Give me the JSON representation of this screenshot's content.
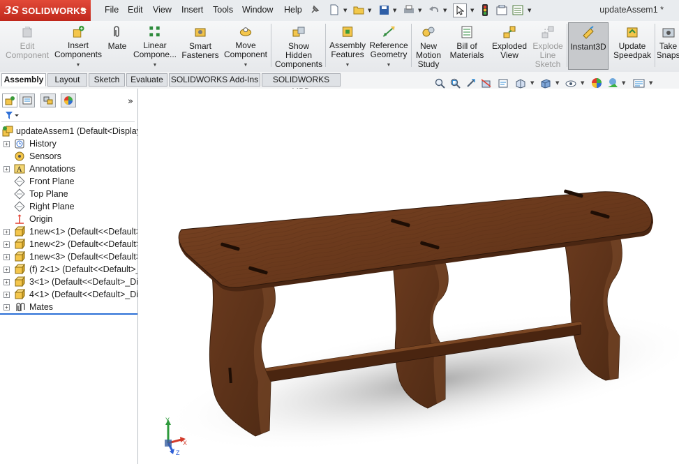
{
  "app": {
    "logo_prefix": "3S",
    "logo_name": "SOLIDWORKS",
    "document_title": "updateAssem1 *"
  },
  "menus": [
    "File",
    "Edit",
    "View",
    "Insert",
    "Tools",
    "Window",
    "Help"
  ],
  "commands": {
    "edit_component": "Edit\nComponent",
    "insert_components": "Insert\nComponents",
    "mate": "Mate",
    "linear_component": "Linear\nCompone...",
    "smart_fasteners": "Smart\nFasteners",
    "move_component": "Move\nComponent",
    "show_hidden": "Show\nHidden\nComponents",
    "assembly_features": "Assembly\nFeatures",
    "reference_geometry": "Reference\nGeometry",
    "new_motion_study": "New\nMotion\nStudy",
    "bill_of_materials": "Bill of\nMaterials",
    "exploded_view": "Exploded\nView",
    "explode_line_sketch": "Explode\nLine\nSketch",
    "instant3d": "Instant3D",
    "update_speedpak": "Update\nSpeedpak",
    "take_snapshot": "Take\nSnaps"
  },
  "tabs": [
    "Assembly",
    "Layout",
    "Sketch",
    "Evaluate",
    "SOLIDWORKS Add-Ins",
    "SOLIDWORKS MBD"
  ],
  "feature_tree": {
    "root": "updateAssem1  (Default<Display",
    "items": [
      {
        "label": "History",
        "expandable": true,
        "icon": "history-icon"
      },
      {
        "label": "Sensors",
        "expandable": false,
        "icon": "sensor-icon"
      },
      {
        "label": "Annotations",
        "expandable": true,
        "icon": "annotation-icon"
      },
      {
        "label": "Front Plane",
        "expandable": false,
        "icon": "plane-icon"
      },
      {
        "label": "Top Plane",
        "expandable": false,
        "icon": "plane-icon"
      },
      {
        "label": "Right Plane",
        "expandable": false,
        "icon": "plane-icon"
      },
      {
        "label": "Origin",
        "expandable": false,
        "icon": "origin-icon"
      },
      {
        "label": "1new<1> (Default<<Default>",
        "expandable": true,
        "icon": "part-icon"
      },
      {
        "label": "1new<2> (Default<<Default>",
        "expandable": true,
        "icon": "part-icon"
      },
      {
        "label": "1new<3> (Default<<Default>",
        "expandable": true,
        "icon": "part-icon"
      },
      {
        "label": "(f) 2<1> (Default<<Default>_",
        "expandable": true,
        "icon": "part-icon"
      },
      {
        "label": "3<1> (Default<<Default>_Dis",
        "expandable": true,
        "icon": "part-icon"
      },
      {
        "label": "4<1> (Default<<Default>_Dis",
        "expandable": true,
        "icon": "part-icon"
      },
      {
        "label": "Mates",
        "expandable": true,
        "icon": "mates-icon"
      }
    ]
  },
  "triad": {
    "x": "X",
    "y": "Y",
    "z": "Z"
  },
  "colors": {
    "logo_red": "#d23a2a",
    "wood_top": "#6e3b1e",
    "wood_side": "#5c2f17",
    "selection_blue": "#2a6fd6"
  }
}
